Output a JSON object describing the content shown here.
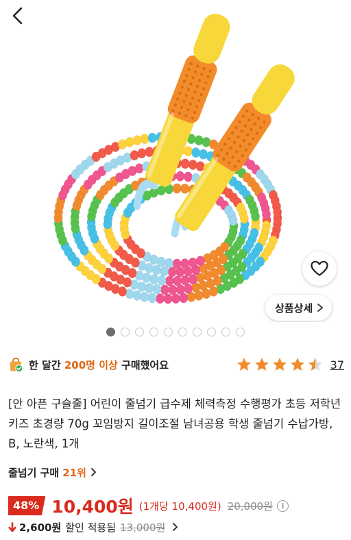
{
  "hero": {
    "detail_button_label": "상품상세",
    "carousel": {
      "count": 10,
      "active_index": 0
    }
  },
  "social_proof": {
    "prefix": "한 달간 ",
    "highlight": "200명 이상",
    "suffix": " 구매했어요"
  },
  "rating": {
    "stars": 4.5,
    "max": 5,
    "review_count": "37"
  },
  "product": {
    "title": "[안 아픈 구슬줄] 어린이 줄넘기 급수제 체력측정 수행평가 초등 저학년 키즈 초경량 70g 꼬임방지 길이조절 남녀공용 학생 줄넘기 수납가방, B, 노란색, 1개"
  },
  "ranking": {
    "category_label": "줄넘기 구매",
    "rank_label": "21위"
  },
  "pricing": {
    "discount_rate": "48%",
    "sale_price": "10,400원",
    "unit_price": "(1개당 10,400원)",
    "original_price": "20,000원",
    "coupon_amount": "2,600원",
    "coupon_label": "할인 적용됨",
    "pre_coupon_price": "13,000원"
  },
  "colors": {
    "accent_orange": "#e0660e",
    "price_red": "#d92b1e",
    "star_orange": "#f08a2b"
  },
  "icons": [
    "back-arrow-icon",
    "heart-icon",
    "chevron-right-icon",
    "shopping-bag-icon",
    "star-icon",
    "info-icon",
    "down-arrow-icon"
  ]
}
